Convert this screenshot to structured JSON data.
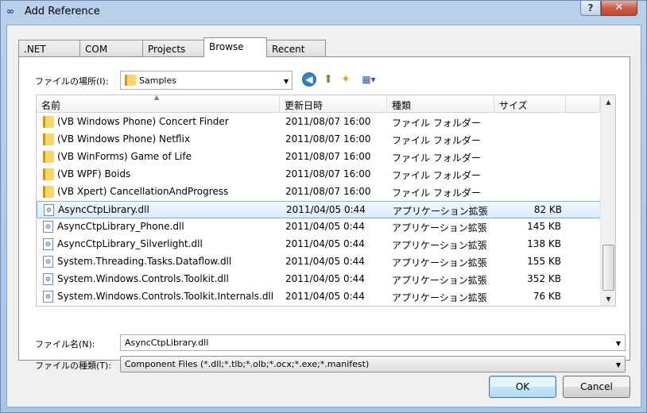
{
  "window": {
    "title": "Add Reference",
    "help_label": "?",
    "close_label": "✕"
  },
  "tabs": [
    {
      "label": ".NET"
    },
    {
      "label": "COM"
    },
    {
      "label": "Projects"
    },
    {
      "label": "Browse",
      "active": true
    },
    {
      "label": "Recent"
    }
  ],
  "location": {
    "label": "ファイルの場所(I):",
    "value": "Samples"
  },
  "toolbar": {
    "back": "back-icon",
    "up": "up-folder-icon",
    "new_folder": "new-folder-icon",
    "views": "views-menu-icon"
  },
  "columns": {
    "name": "名前",
    "date": "更新日時",
    "type": "種類",
    "size": "サイズ"
  },
  "files": [
    {
      "name": "(VB Windows Phone) Concert Finder",
      "date": "2011/08/07 16:00",
      "type": "ファイル フォルダー",
      "size": "",
      "kind": "folder"
    },
    {
      "name": "(VB Windows Phone) Netflix",
      "date": "2011/08/07 16:00",
      "type": "ファイル フォルダー",
      "size": "",
      "kind": "folder"
    },
    {
      "name": "(VB WinForms) Game of Life",
      "date": "2011/08/07 16:00",
      "type": "ファイル フォルダー",
      "size": "",
      "kind": "folder"
    },
    {
      "name": "(VB WPF) Boids",
      "date": "2011/08/07 16:00",
      "type": "ファイル フォルダー",
      "size": "",
      "kind": "folder"
    },
    {
      "name": "(VB Xpert) CancellationAndProgress",
      "date": "2011/08/07 16:00",
      "type": "ファイル フォルダー",
      "size": "",
      "kind": "folder"
    },
    {
      "name": "AsyncCtpLibrary.dll",
      "date": "2011/04/05 0:44",
      "type": "アプリケーション拡張",
      "size": "82 KB",
      "kind": "dll",
      "selected": true
    },
    {
      "name": "AsyncCtpLibrary_Phone.dll",
      "date": "2011/04/05 0:44",
      "type": "アプリケーション拡張",
      "size": "145 KB",
      "kind": "dll"
    },
    {
      "name": "AsyncCtpLibrary_Silverlight.dll",
      "date": "2011/04/05 0:44",
      "type": "アプリケーション拡張",
      "size": "138 KB",
      "kind": "dll"
    },
    {
      "name": "System.Threading.Tasks.Dataflow.dll",
      "date": "2011/04/05 0:44",
      "type": "アプリケーション拡張",
      "size": "155 KB",
      "kind": "dll"
    },
    {
      "name": "System.Windows.Controls.Toolkit.dll",
      "date": "2011/04/05 0:44",
      "type": "アプリケーション拡張",
      "size": "352 KB",
      "kind": "dll"
    },
    {
      "name": "System.Windows.Controls.Toolkit.Internals.dll",
      "date": "2011/04/05 0:44",
      "type": "アプリケーション拡張",
      "size": "76 KB",
      "kind": "dll"
    }
  ],
  "filename": {
    "label": "ファイル名(N):",
    "value": "AsyncCtpLibrary.dll"
  },
  "filetype": {
    "label": "ファイルの種類(T):",
    "value": "Component Files (*.dll;*.tlb;*.olb;*.ocx;*.exe;*.manifest)"
  },
  "buttons": {
    "ok": "OK",
    "cancel": "Cancel"
  }
}
